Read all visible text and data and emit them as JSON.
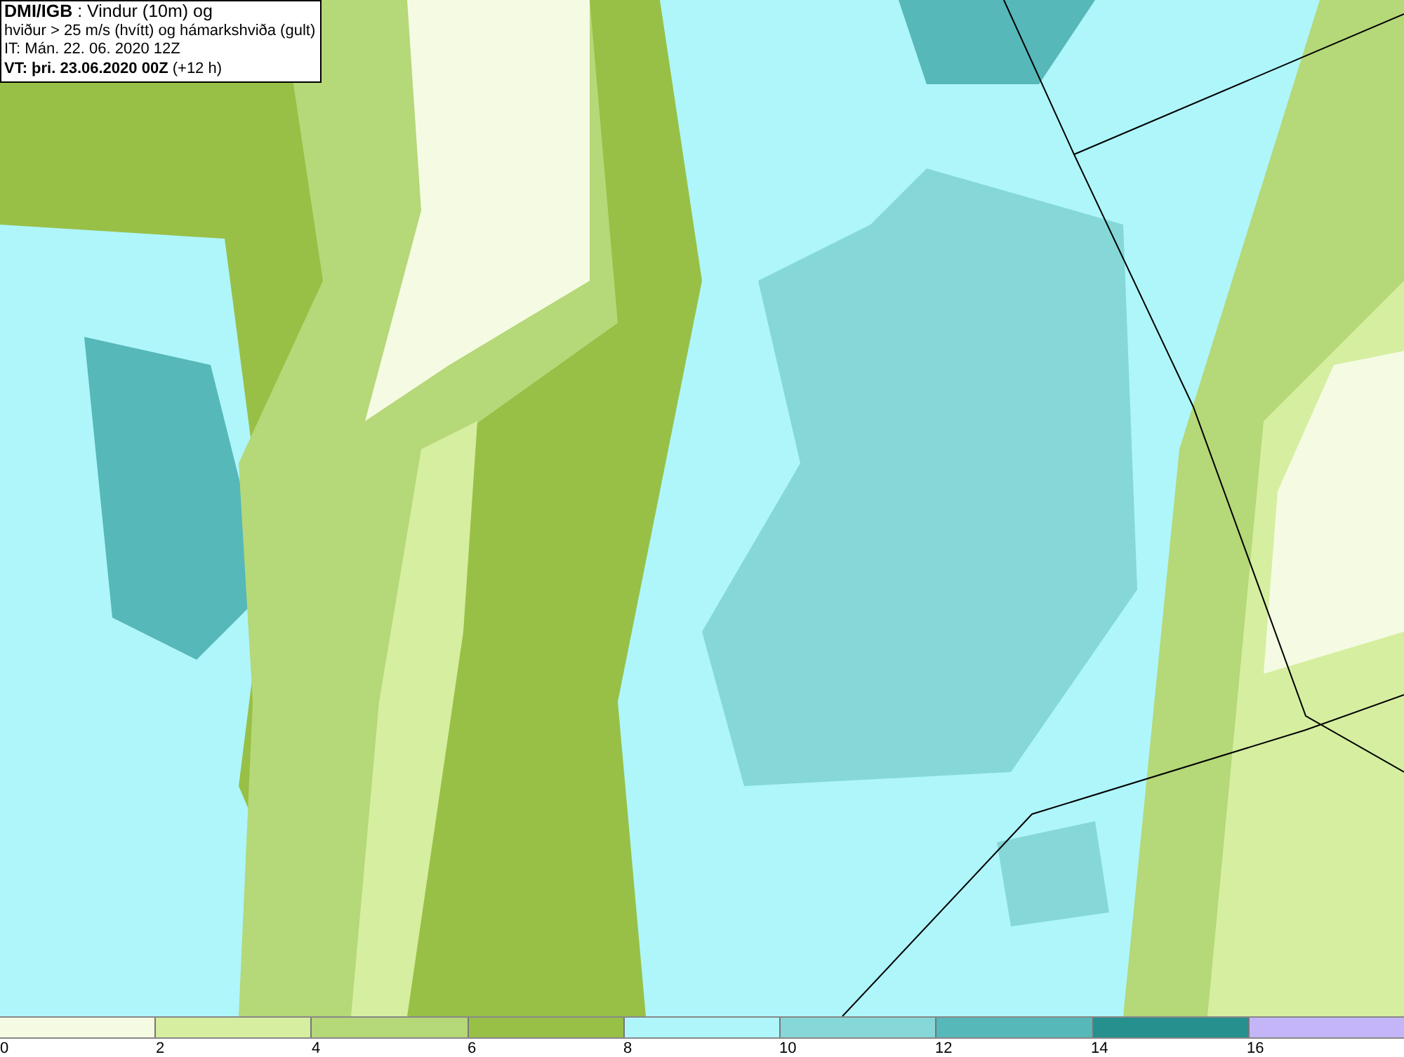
{
  "title_box": {
    "lines": [
      "**DMI/IGB** : Vindur (10m) og",
      "hviður > 25 m/s (hvítt) og hámarkshviða (gult)",
      "IT: Mán. 22. 06. 2020 12Z",
      "**VT: þri. 23.06.2020 00Z** (+12 h)"
    ]
  },
  "legend": {
    "segments": [
      {
        "color": "#f5fbe3"
      },
      {
        "color": "#d6eea0"
      },
      {
        "color": "#b5d878"
      },
      {
        "color": "#98c046"
      },
      {
        "color": "#aef6fa"
      },
      {
        "color": "#86d8d8"
      },
      {
        "color": "#56b8b8"
      },
      {
        "color": "#25908e"
      },
      {
        "color": "#c4b5f8"
      }
    ],
    "labels": [
      "0",
      "2",
      "4",
      "6",
      "8",
      "10",
      "12",
      "14",
      "16"
    ]
  }
}
